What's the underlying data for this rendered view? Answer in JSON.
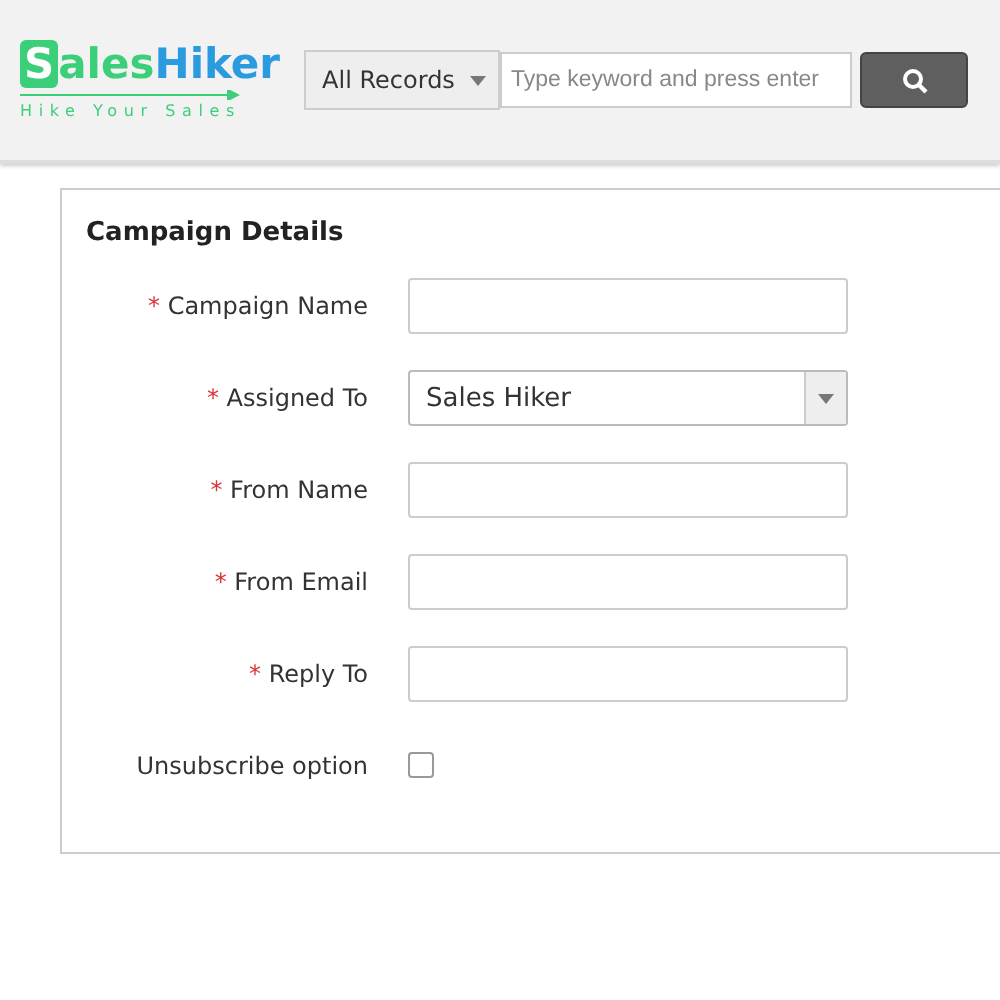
{
  "logo": {
    "initial": "S",
    "first": "ales",
    "second": "Hiker",
    "tagline": "Hike Your Sales"
  },
  "search": {
    "scope": "All Records",
    "placeholder": "Type keyword and press enter"
  },
  "section": {
    "title": "Campaign Details"
  },
  "fields": [
    {
      "kind": "text",
      "label": "Campaign Name",
      "required_mark": "*"
    },
    {
      "kind": "select",
      "label": "Assigned To",
      "required_mark": "*",
      "value": "Sales Hiker"
    },
    {
      "kind": "text",
      "label": "From Name",
      "required_mark": "*"
    },
    {
      "kind": "text",
      "label": "From Email",
      "required_mark": "*"
    },
    {
      "kind": "text",
      "label": "Reply To",
      "required_mark": "*"
    },
    {
      "kind": "checkbox",
      "label": "Unsubscribe option",
      "checked": false
    }
  ]
}
